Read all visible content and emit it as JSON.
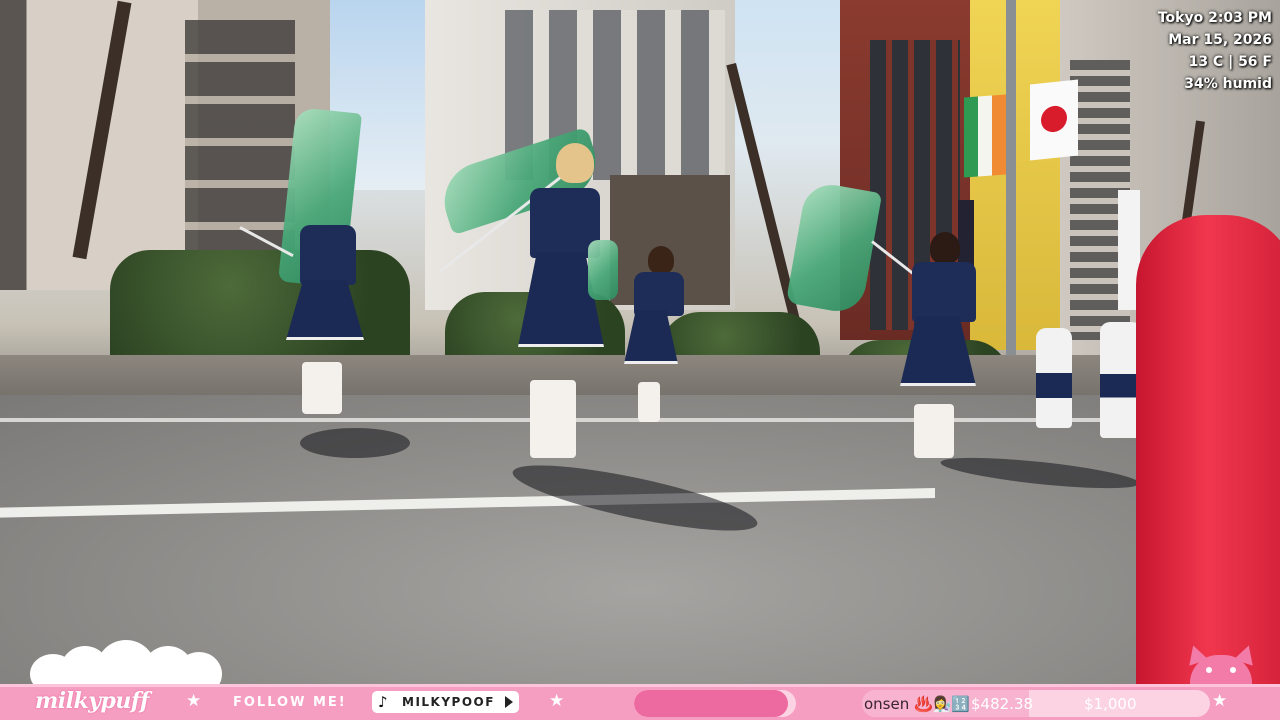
{
  "overlay": {
    "weather": {
      "location_time": "Tokyo 2:03 PM",
      "date": "Mar 15, 2026",
      "temperature": "13 C | 56 F",
      "humidity": "34% humid"
    },
    "bottom_bar": {
      "brand": "milkypuff",
      "follow_label": "FOLLOW ME!",
      "tiktok_handle": "MILKYPOOF",
      "goal_progress_fraction": 0.95,
      "donation": {
        "ticker": "onsen ♨️👩‍🔬🔢",
        "amount": "$482.38",
        "goal": "$1,000",
        "progress_fraction": 0.48
      }
    },
    "colors": {
      "bar_pink": "#f69ec2",
      "accent_pink": "#ec6aa0",
      "cone_red": "#f0374e"
    },
    "icons": [
      "tiktok-icon",
      "play-icon",
      "star-icon",
      "cat-ears-icon",
      "cloud-icon"
    ]
  }
}
